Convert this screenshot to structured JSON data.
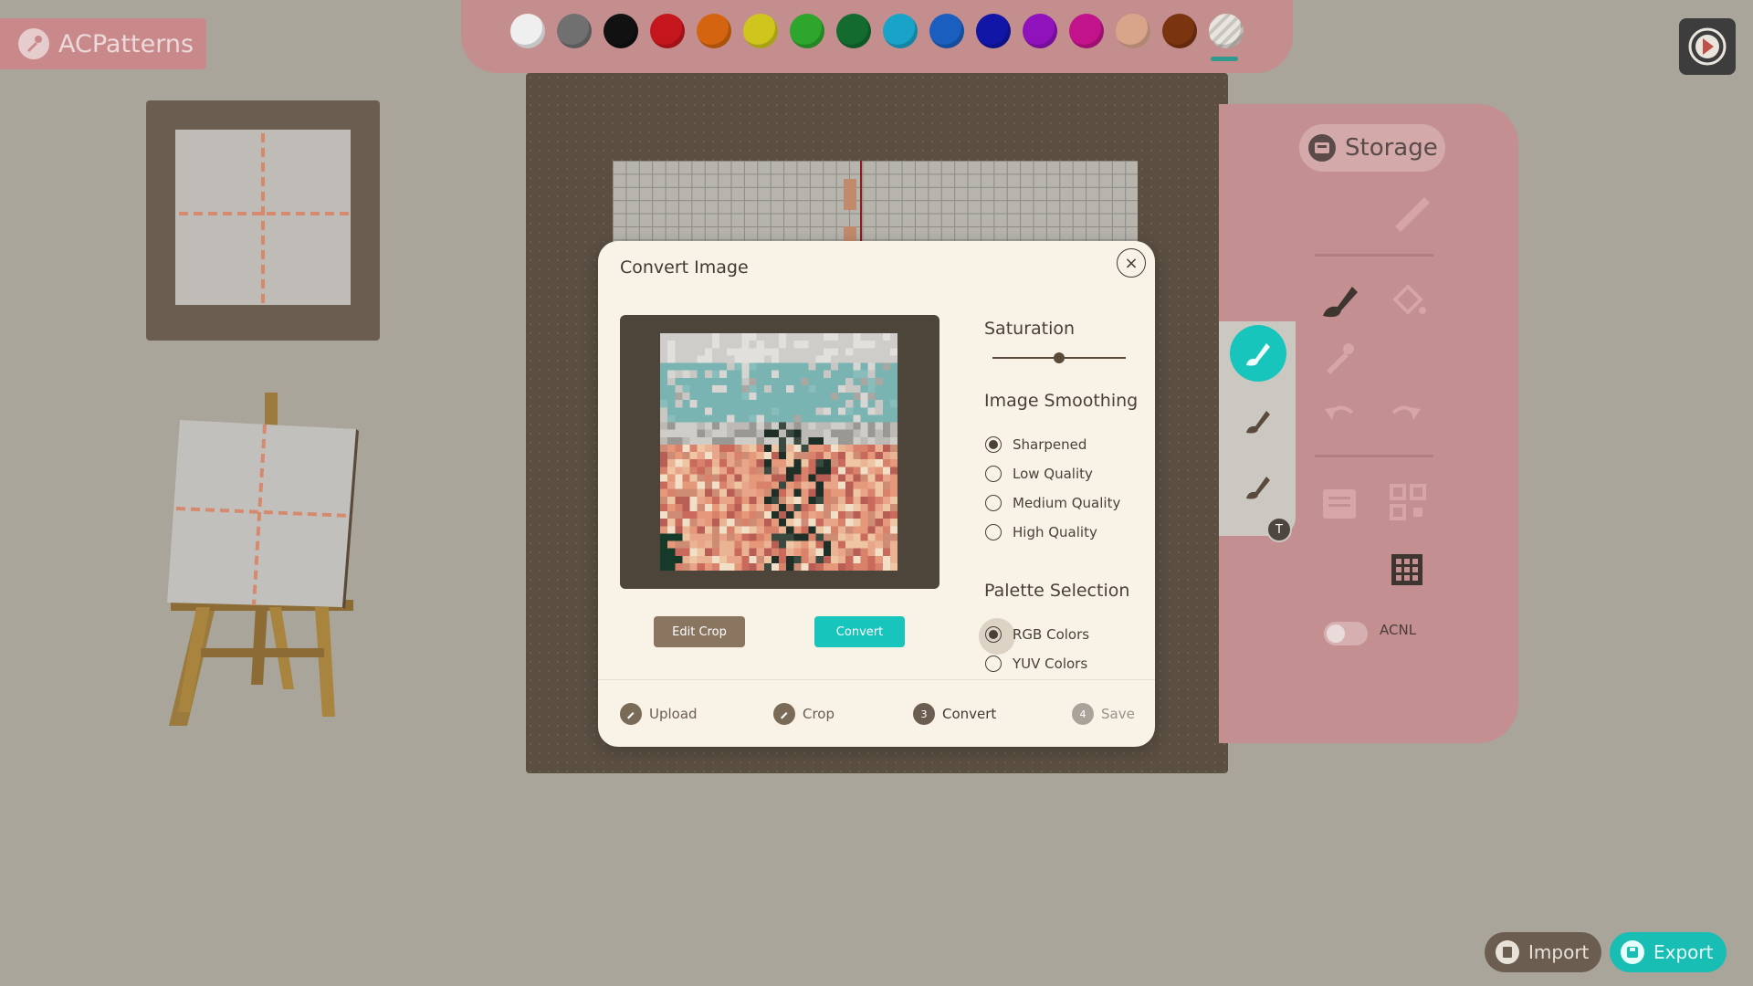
{
  "app": {
    "name": "ACPatterns"
  },
  "palette": {
    "swatches": [
      "#efefef",
      "#707070",
      "#111111",
      "#c4161c",
      "#d4640f",
      "#cfc51c",
      "#2ea52d",
      "#146b2f",
      "#1aa3c9",
      "#1a5fc0",
      "#1216a6",
      "#8f12bd",
      "#c2138c",
      "#d8a58b",
      "#7a3410",
      "striped"
    ]
  },
  "side_panel": {
    "storage_label": "Storage",
    "acnl_label": "ACNL",
    "tool_badge": "T"
  },
  "modal": {
    "title": "Convert Image",
    "saturation_label": "Saturation",
    "saturation_value": 0.5,
    "smoothing_label": "Image Smoothing",
    "smoothing_options": [
      "Sharpened",
      "Low Quality",
      "Medium Quality",
      "High Quality"
    ],
    "smoothing_selected": "Sharpened",
    "palette_label": "Palette Selection",
    "palette_options": [
      "RGB Colors",
      "YUV Colors"
    ],
    "palette_selected": "RGB Colors",
    "edit_crop_label": "Edit Crop",
    "convert_label": "Convert",
    "close_symbol": "×"
  },
  "steps": [
    {
      "label": "Upload",
      "badge": "",
      "state": "done"
    },
    {
      "label": "Crop",
      "badge": "",
      "state": "done"
    },
    {
      "label": "Convert",
      "badge": "3",
      "state": "current"
    },
    {
      "label": "Save",
      "badge": "4",
      "state": "pending"
    }
  ],
  "bottom": {
    "import_label": "Import",
    "export_label": "Export"
  },
  "colors": {
    "accent": "#18c5bc",
    "panel_pink": "#c38f91",
    "brown": "#5b4f42"
  }
}
